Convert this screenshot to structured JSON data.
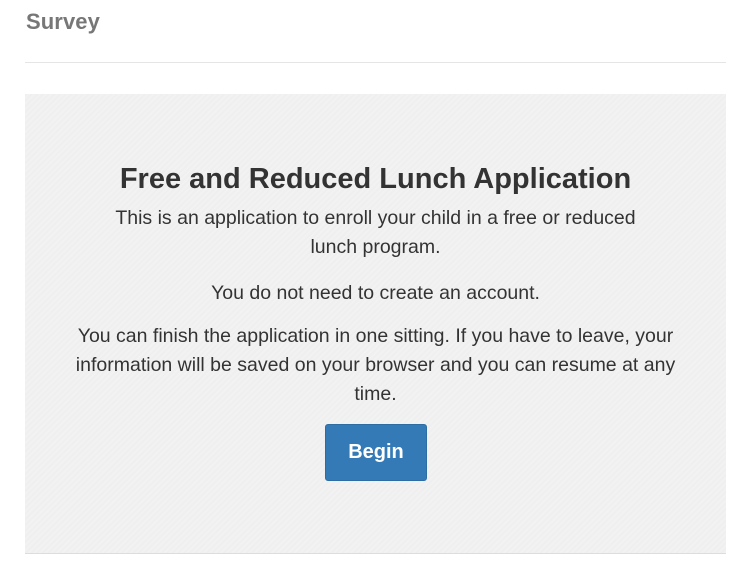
{
  "header": {
    "brand": "Survey"
  },
  "main": {
    "title": "Free and Reduced Lunch Application",
    "paragraph_intro": "This is an application to enroll your child in a free or reduced lunch program.",
    "paragraph_account": "You do not need to create an account.",
    "paragraph_resume": "You can finish the application in one sitting. If you have to leave, your information will be saved on your browser and you can resume at any time.",
    "begin_label": "Begin"
  },
  "colors": {
    "primary_button": "#337ab7",
    "panel_background": "#f2f2f2",
    "brand_text": "#777777"
  }
}
